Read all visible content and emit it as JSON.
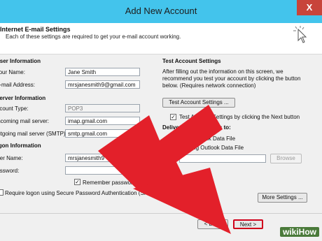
{
  "window": {
    "title": "Add New Account",
    "close_glyph": "X"
  },
  "header": {
    "title": "Internet E-mail Settings",
    "subtitle": "Each of these settings are required to get your e-mail account working."
  },
  "left": {
    "user_info_title": "User Information",
    "name_label": "Your Name:",
    "name_value": "Jane Smith",
    "email_label": "E-mail Address:",
    "email_value": "mrsjanesmith9@gmail.com",
    "server_info_title": "Server Information",
    "account_type_label": "Account Type:",
    "account_type_value": "POP3",
    "incoming_label": "Incoming mail server:",
    "incoming_value": "imap.gmail.com",
    "outgoing_label": "Outgoing mail server (SMTP):",
    "outgoing_value": "smtp.gmail.com",
    "logon_title": "Logon Information",
    "username_label": "User Name:",
    "username_value": "mrsjanesmith9",
    "password_label": "Password:",
    "password_value": "",
    "remember_label": "Remember password",
    "spa_label": "Require logon using Secure Password Authentication (SPA)"
  },
  "right": {
    "test_title": "Test Account Settings",
    "test_text": "After filling out the information on this screen, we recommend you test your account by clicking the button below. (Requires network connection)",
    "test_button": "Test Account Settings ...",
    "test_check_label": "Test Account Settings by clicking the Next button",
    "deliver_title": "Deliver new messages to:",
    "new_file_label": "New Outlook Data File",
    "existing_file_label": "Existing Outlook Data File",
    "browse_button": "Browse",
    "more_settings_button": "More Settings ..."
  },
  "footer": {
    "back_button": "< Back",
    "next_button": "Next >"
  },
  "watermark": {
    "wiki": "wiki",
    "how": "How"
  },
  "colors": {
    "titlebar": "#43c4ec",
    "arrow": "#e3202a",
    "highlight": "#d0021b"
  }
}
